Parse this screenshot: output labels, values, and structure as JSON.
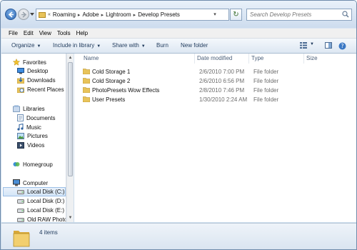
{
  "address": {
    "breadcrumbs": [
      "Roaming",
      "Adobe",
      "Lightroom",
      "Develop Presets"
    ],
    "overflow": "«"
  },
  "search": {
    "placeholder": "Search Develop Presets"
  },
  "menu": [
    "File",
    "Edit",
    "View",
    "Tools",
    "Help"
  ],
  "toolbar": {
    "organize": "Organize",
    "include": "Include in library",
    "share": "Share with",
    "burn": "Burn",
    "new_folder": "New folder"
  },
  "nav": {
    "favorites": "Favorites",
    "desktop": "Desktop",
    "downloads": "Downloads",
    "recent": "Recent Places",
    "libraries": "Libraries",
    "documents": "Documents",
    "music": "Music",
    "pictures": "Pictures",
    "videos": "Videos",
    "homegroup": "Homegroup",
    "computer": "Computer",
    "disk_c": "Local Disk (C:)",
    "disk_d": "Local Disk (D:)",
    "disk_e": "Local Disk (E:)",
    "old_raw": "Old RAW Photos"
  },
  "columns": {
    "name": "Name",
    "date": "Date modified",
    "type": "Type",
    "size": "Size"
  },
  "files": [
    {
      "name": "Cold Storage 1",
      "date": "2/6/2010 7:00 PM",
      "type": "File folder"
    },
    {
      "name": "Cold Storage 2",
      "date": "2/6/2010 6:56 PM",
      "type": "File folder"
    },
    {
      "name": "PhotoPresets Wow Effects",
      "date": "2/8/2010 7:46 PM",
      "type": "File folder"
    },
    {
      "name": "User Presets",
      "date": "1/30/2010 2:24 AM",
      "type": "File folder"
    }
  ],
  "status": {
    "count": "4 items"
  },
  "colors": {
    "accent": "#1e395b",
    "folder": "#e8c35a",
    "selection": "#d4e5f7"
  }
}
